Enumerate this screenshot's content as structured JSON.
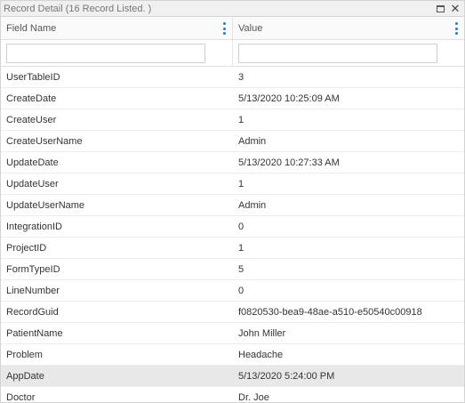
{
  "window": {
    "title": "Record Detail (16 Record Listed. )"
  },
  "grid": {
    "columns": [
      "Field Name",
      "Value"
    ],
    "selected_row": 14,
    "rows": [
      {
        "field": "UserTableID",
        "value": "3"
      },
      {
        "field": "CreateDate",
        "value": "5/13/2020 10:25:09 AM"
      },
      {
        "field": "CreateUser",
        "value": "1"
      },
      {
        "field": "CreateUserName",
        "value": " Admin"
      },
      {
        "field": "UpdateDate",
        "value": "5/13/2020 10:27:33 AM"
      },
      {
        "field": "UpdateUser",
        "value": "1"
      },
      {
        "field": "UpdateUserName",
        "value": "Admin"
      },
      {
        "field": "IntegrationID",
        "value": "0"
      },
      {
        "field": "ProjectID",
        "value": "1"
      },
      {
        "field": "FormTypeID",
        "value": "5"
      },
      {
        "field": "LineNumber",
        "value": "0"
      },
      {
        "field": "RecordGuid",
        "value": "f0820530-bea9-48ae-a510-e50540c00918"
      },
      {
        "field": "PatientName",
        "value": "John Miller"
      },
      {
        "field": "Problem",
        "value": "Headache"
      },
      {
        "field": "AppDate",
        "value": "5/13/2020 5:24:00 PM"
      },
      {
        "field": "Doctor",
        "value": "Dr. Joe"
      }
    ]
  },
  "icons": {
    "restore": "restore-window-icon",
    "close": "close-icon",
    "column_menu": "vertical-ellipsis-icon"
  },
  "colors": {
    "accent": "#1e7bd6",
    "selected_row": "#e8e8e8",
    "titlebar": "#f0f0f0"
  }
}
